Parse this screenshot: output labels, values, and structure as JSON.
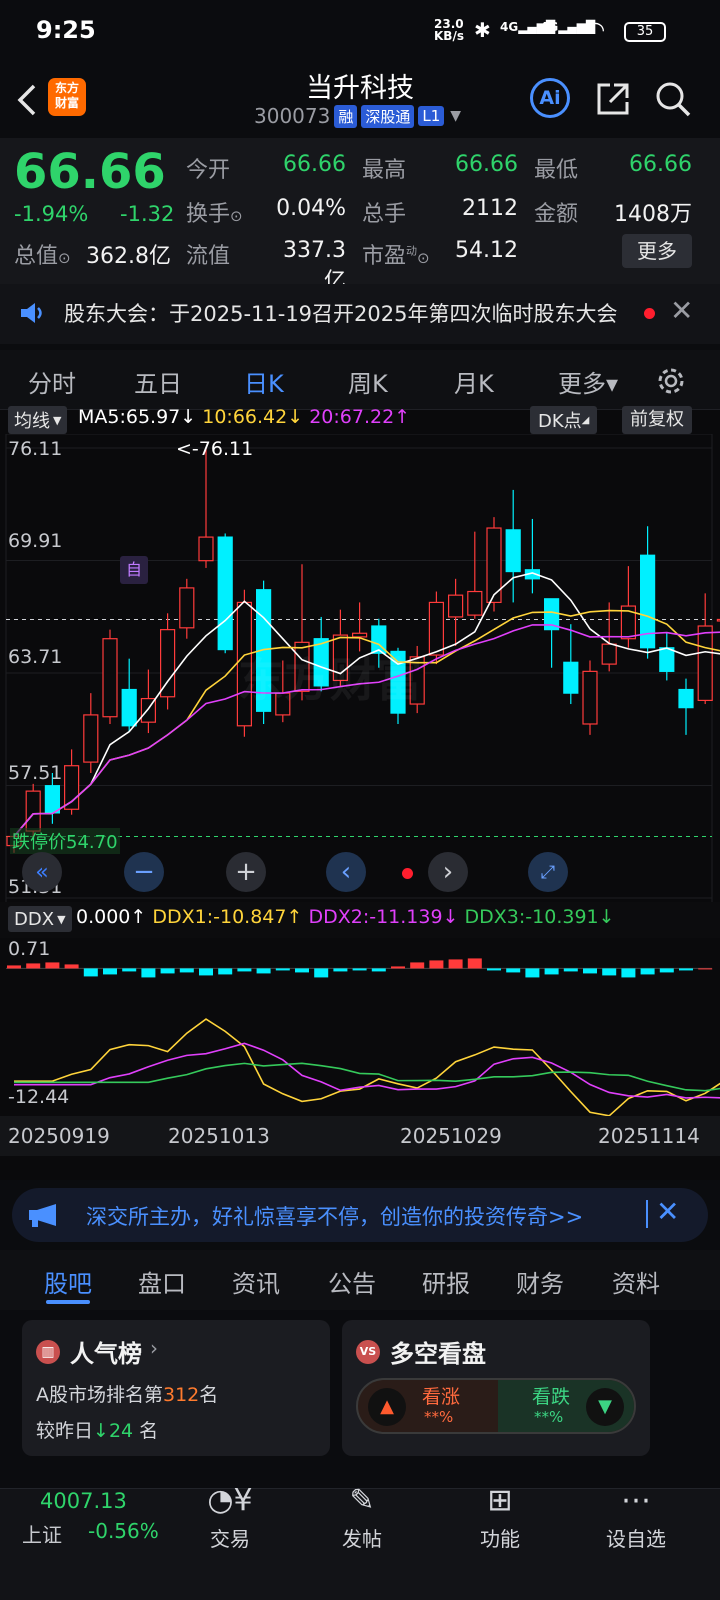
{
  "status_bar": {
    "time": "9:25",
    "speed": "23.0\nKB/s",
    "battery": "35"
  },
  "header": {
    "title": "当升科技",
    "code": "300073",
    "tags": [
      "融",
      "深股通",
      "L1"
    ],
    "logo_text": "东方\n财富",
    "ai": "Ai"
  },
  "quote": {
    "price": "66.66",
    "change_pct": "-1.94%",
    "change": "-1.32",
    "fields": [
      {
        "label": "今开",
        "value": "66.66"
      },
      {
        "label": "最高",
        "value": "66.66"
      },
      {
        "label": "最低",
        "value": "66.66"
      },
      {
        "label": "换手",
        "value": "0.04%"
      },
      {
        "label": "总手",
        "value": "2112"
      },
      {
        "label": "金额",
        "value": "1408万"
      },
      {
        "label": "总值",
        "value": "362.8亿"
      },
      {
        "label": "流值",
        "value": "337.3亿"
      },
      {
        "label": "市盈",
        "value": "54.12"
      }
    ],
    "more": "更多",
    "pe_sup": "动"
  },
  "notice": {
    "text": "股东大会：于2025-11-19召开2025年第四次临时股东大会"
  },
  "period_tabs": [
    "分时",
    "五日",
    "日K",
    "周K",
    "月K",
    "更多▾"
  ],
  "active_period": "日K",
  "chart_toolbar": {
    "indicator": "均线",
    "ma5": "MA5:65.97",
    "ma10": "10:66.42",
    "ma20": "20:67.22",
    "dk": "DK点",
    "fq": "前复权"
  },
  "price_axis": [
    "76.11",
    "69.91",
    "63.71",
    "57.51",
    "51.31"
  ],
  "max_label": "<-76.11",
  "limit_label": "跌停价54.70",
  "self_tag": "自",
  "watermark": "东方财富",
  "ddx_toolbar": {
    "name": "DDX",
    "v": "0.000",
    "d1": "DDX1:-10.847",
    "d2": "DDX2:-11.139",
    "d3": "DDX3:-10.391"
  },
  "ddx_axis": [
    "0.71",
    "-12.44"
  ],
  "dates": [
    "20250919",
    "20251013",
    "20251029",
    "20251114"
  ],
  "chart_data": {
    "type": "candlestick",
    "ylim": [
      51.31,
      76.11
    ],
    "candles": [
      [
        54.2,
        54.7,
        54.9,
        53.8
      ],
      [
        55.0,
        57.2,
        57.6,
        54.6
      ],
      [
        57.5,
        56.0,
        58.2,
        55.4
      ],
      [
        56.2,
        58.6,
        59.5,
        55.9
      ],
      [
        58.8,
        61.4,
        62.6,
        58.2
      ],
      [
        61.3,
        65.6,
        66.1,
        60.9
      ],
      [
        62.8,
        60.8,
        64.5,
        60.5
      ],
      [
        61.0,
        62.3,
        63.9,
        60.4
      ],
      [
        62.4,
        66.1,
        67.0,
        61.7
      ],
      [
        66.2,
        68.4,
        68.9,
        65.6
      ],
      [
        69.9,
        71.2,
        76.11,
        69.5
      ],
      [
        71.2,
        65.0,
        71.4,
        64.8
      ],
      [
        60.8,
        67.6,
        68.3,
        60.2
      ],
      [
        68.3,
        61.6,
        68.8,
        60.9
      ],
      [
        61.4,
        62.6,
        64.4,
        61.0
      ],
      [
        62.7,
        65.4,
        69.7,
        62.2
      ],
      [
        65.6,
        63.0,
        66.8,
        62.7
      ],
      [
        63.3,
        65.8,
        67.2,
        63.0
      ],
      [
        65.7,
        65.9,
        67.6,
        64.9
      ],
      [
        66.3,
        64.8,
        66.7,
        64.0
      ],
      [
        64.9,
        61.5,
        65.1,
        60.9
      ],
      [
        62.0,
        64.6,
        65.2,
        61.5
      ],
      [
        64.7,
        67.6,
        68.2,
        64.2
      ],
      [
        66.8,
        68.0,
        68.9,
        65.2
      ],
      [
        66.9,
        68.2,
        71.5,
        66.7
      ],
      [
        67.6,
        71.7,
        72.3,
        67.1
      ],
      [
        71.6,
        69.3,
        73.8,
        67.6
      ],
      [
        69.4,
        68.9,
        72.2,
        68.1
      ],
      [
        67.8,
        66.1,
        67.8,
        64.0
      ],
      [
        64.3,
        62.6,
        66.4,
        62.0
      ],
      [
        60.9,
        63.8,
        64.4,
        60.3
      ],
      [
        64.2,
        65.3,
        67.6,
        63.8
      ],
      [
        65.6,
        67.4,
        69.6,
        65.1
      ],
      [
        70.2,
        65.1,
        71.8,
        64.5
      ],
      [
        65.1,
        63.8,
        65.9,
        63.3
      ],
      [
        62.8,
        61.8,
        63.4,
        60.3
      ],
      [
        62.2,
        66.3,
        68.1,
        62.0
      ],
      [
        66.66,
        66.66,
        66.66,
        66.66
      ]
    ],
    "ddx_bars": [
      0.3,
      0.5,
      0.6,
      0.4,
      -0.8,
      -0.6,
      -0.3,
      -0.9,
      -0.5,
      -0.4,
      -0.7,
      -0.6,
      -0.3,
      -0.5,
      -0.2,
      -0.4,
      -0.9,
      -0.3,
      -0.2,
      -0.3,
      0.2,
      0.6,
      0.8,
      0.9,
      1.0,
      -0.2,
      -0.4,
      -0.9,
      -0.6,
      -0.3,
      -0.5,
      -0.7,
      -0.9,
      -0.6,
      -0.4,
      -0.2,
      0.0
    ],
    "ddx_range": [
      -12.44,
      0.71
    ]
  },
  "ad_bar": {
    "text": "深交所主办，好礼惊喜享不停，创造你的投资传奇>>"
  },
  "sub_tabs": [
    "股吧",
    "盘口",
    "资讯",
    "公告",
    "研报",
    "财务",
    "资料"
  ],
  "active_sub": "股吧",
  "card_left": {
    "title": "人气榜",
    "line1a": "A股市场排名第",
    "rank": "312",
    "line1b": "名",
    "line2a": "较昨日",
    "delta": "24",
    "line2b": "名"
  },
  "card_right": {
    "title": "多空看盘",
    "bull": "看涨",
    "bear": "看跌",
    "pct": "**%"
  },
  "index": {
    "value": "4007.13",
    "name": "上证",
    "pct": "-0.56%"
  },
  "bottom_nav": [
    "交易",
    "发帖",
    "功能",
    "设自选"
  ]
}
